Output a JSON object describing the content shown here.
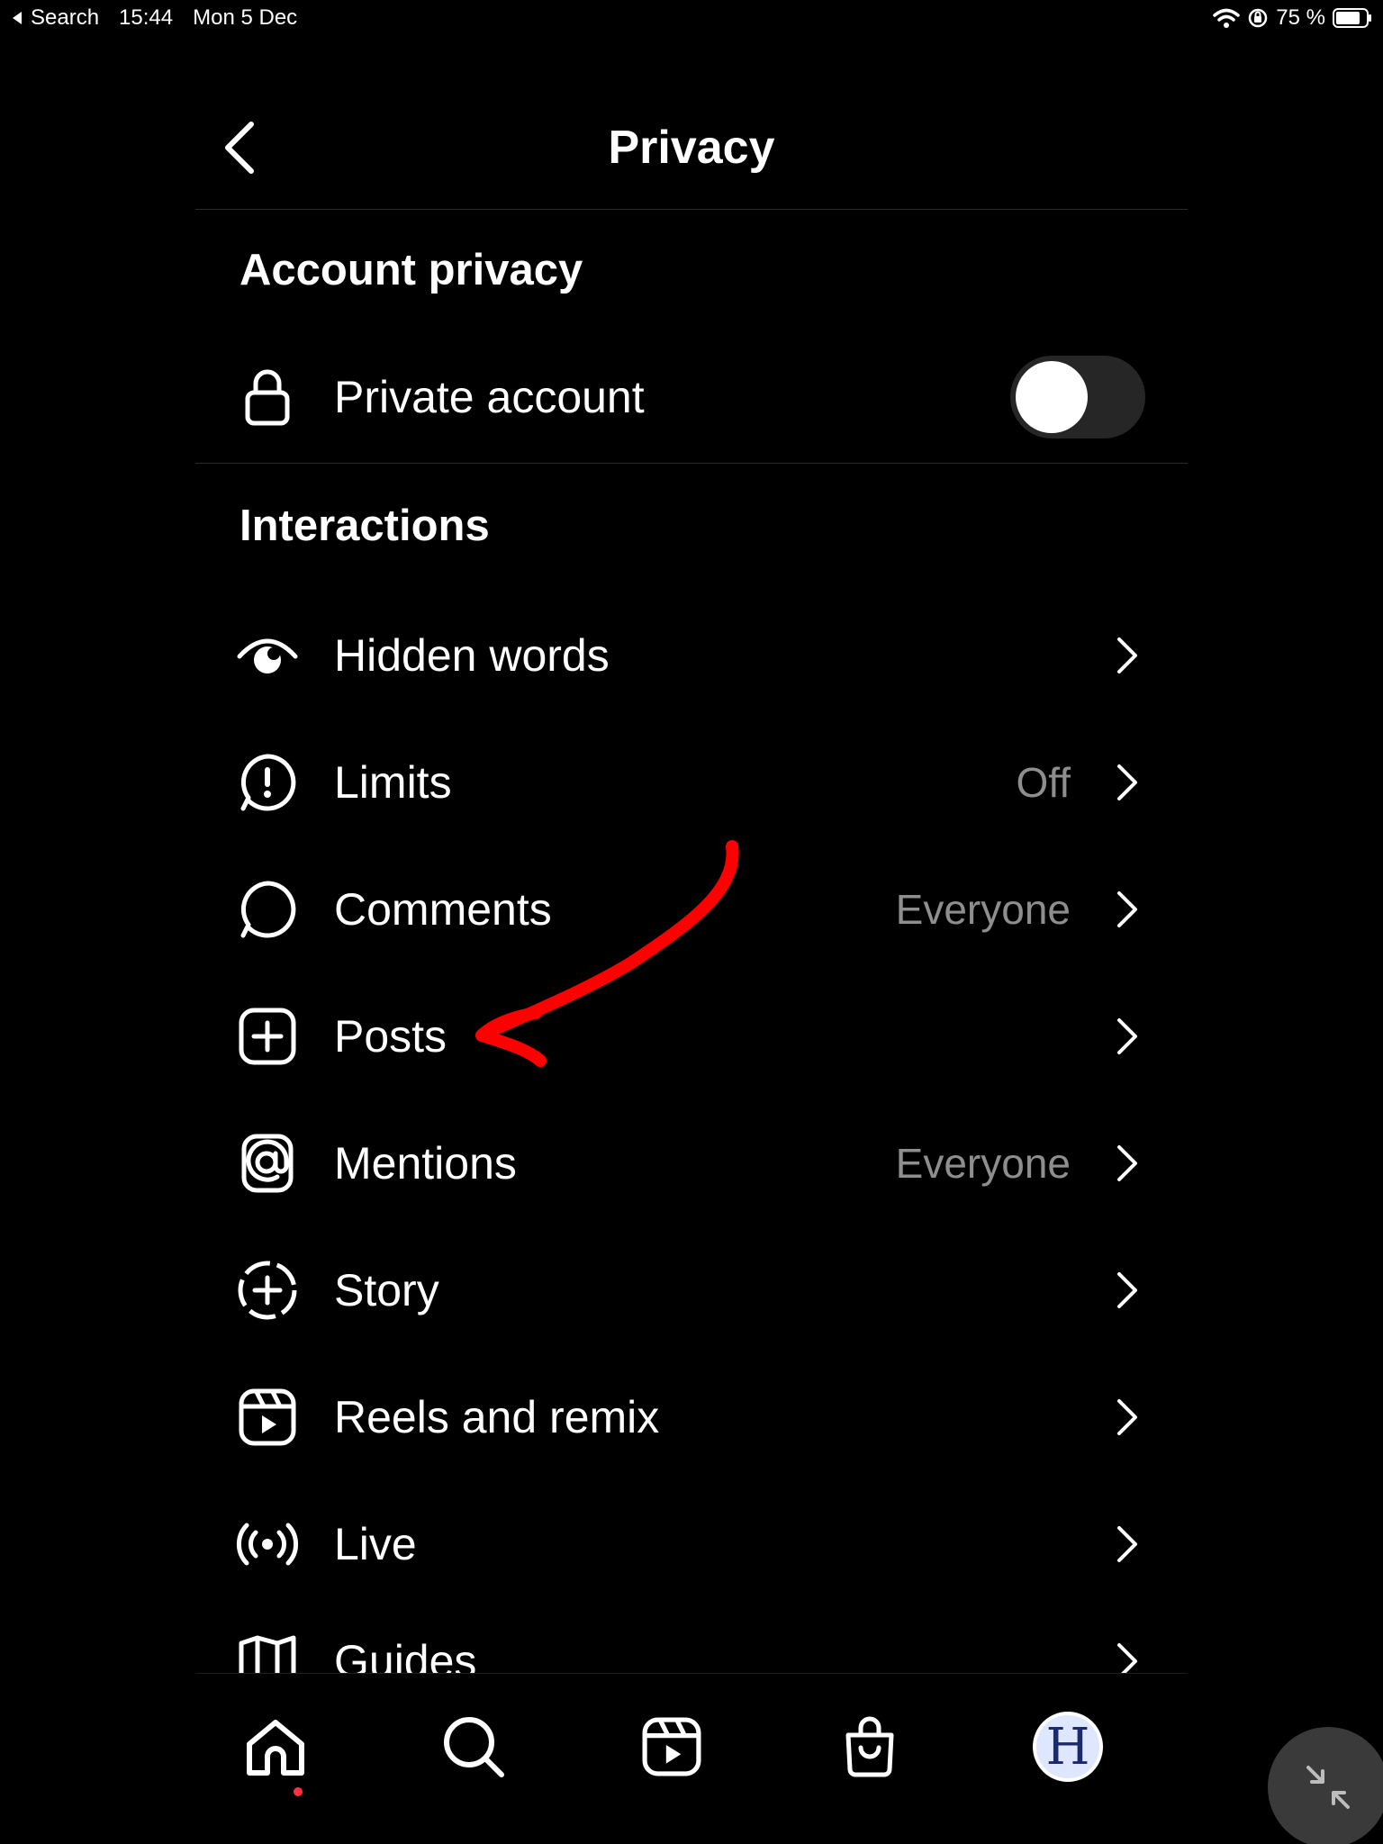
{
  "status_bar": {
    "back_label": "Search",
    "time": "15:44",
    "date": "Mon 5 Dec",
    "battery": "75 %"
  },
  "header": {
    "title": "Privacy"
  },
  "sections": {
    "account_privacy": "Account privacy",
    "interactions": "Interactions"
  },
  "private_account": {
    "label": "Private account",
    "enabled": false
  },
  "rows": [
    {
      "label": "Hidden words",
      "value": "",
      "icon": "eye-icon"
    },
    {
      "label": "Limits",
      "value": "Off",
      "icon": "alert-bubble-icon"
    },
    {
      "label": "Comments",
      "value": "Everyone",
      "icon": "comment-icon"
    },
    {
      "label": "Posts",
      "value": "",
      "icon": "plus-square-icon"
    },
    {
      "label": "Mentions",
      "value": "Everyone",
      "icon": "at-icon"
    },
    {
      "label": "Story",
      "value": "",
      "icon": "story-plus-icon"
    },
    {
      "label": "Reels and remix",
      "value": "",
      "icon": "reels-icon"
    },
    {
      "label": "Live",
      "value": "",
      "icon": "live-icon"
    },
    {
      "label": "Guides",
      "value": "",
      "icon": "guides-icon"
    }
  ],
  "bottom_nav": {
    "items": [
      "home-icon",
      "search-icon",
      "reels-icon",
      "shop-icon",
      "profile-avatar"
    ],
    "avatar_letter": "H",
    "active_dot_color": "#ff3040"
  },
  "annotation": {
    "arrow_color": "#ff0000",
    "points_to": "Posts"
  }
}
